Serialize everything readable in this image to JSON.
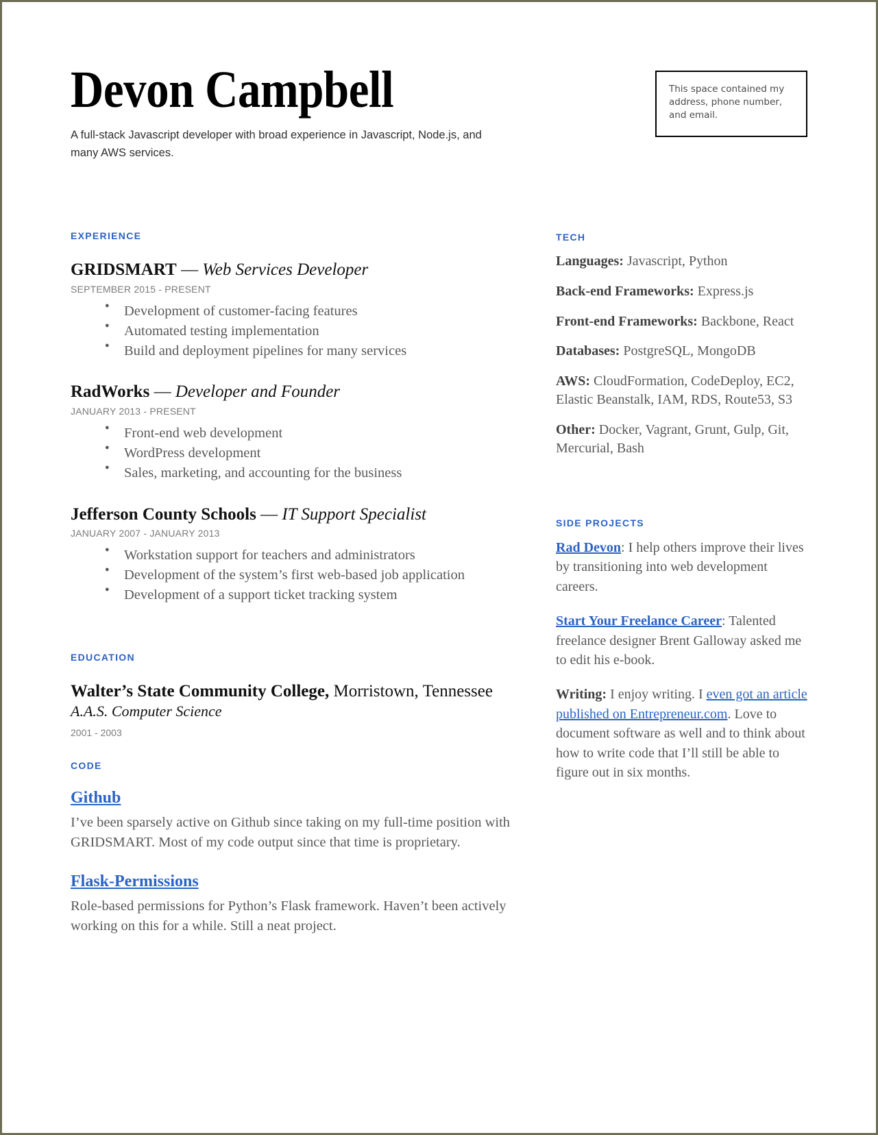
{
  "header": {
    "name": "Devon Campbell",
    "tagline": "A full-stack Javascript developer with broad experience in Javascript, Node.js, and many AWS services.",
    "contact_box_text": "This space contained my address, phone number, and email."
  },
  "sections": {
    "experience_heading": "EXPERIENCE",
    "education_heading": "EDUCATION",
    "code_heading": "CODE",
    "tech_heading": "TECH",
    "side_projects_heading": "SIDE PROJECTS"
  },
  "experience": [
    {
      "company": "GRIDSMART",
      "dash": " — ",
      "role": "Web Services Developer",
      "dates": "SEPTEMBER 2015 - PRESENT",
      "bullets": [
        "Development of customer-facing features",
        "Automated testing implementation",
        "Build and deployment pipelines for many services"
      ]
    },
    {
      "company": "RadWorks",
      "dash": " — ",
      "role": "Developer and Founder",
      "dates": "JANUARY 2013 - PRESENT",
      "bullets": [
        "Front-end web development",
        "WordPress development",
        "Sales, marketing, and accounting for the business"
      ]
    },
    {
      "company": "Jefferson County Schools",
      "dash": " — ",
      "role": "IT Support Specialist",
      "dates": "JANUARY 2007 - JANUARY 2013",
      "bullets": [
        "Workstation support for teachers and administrators",
        "Development of the system’s first web-based job application",
        "Development of a support ticket tracking system"
      ]
    }
  ],
  "education": {
    "school": "Walter’s State Community College,",
    "location": " Morristown, Tennessee",
    "degree": "A.A.S. Computer Science",
    "years": "2001 - 2003"
  },
  "code": [
    {
      "link": "Github",
      "description": "I’ve been sparsely active on Github since taking on my full-time position with GRIDSMART. Most of my code output since that time is proprietary."
    },
    {
      "link": "Flask-Permissions",
      "description": "Role-based permissions for Python’s Flask framework. Haven’t been actively working on this for a while. Still a neat project."
    }
  ],
  "tech": [
    {
      "label": "Languages:",
      "value": " Javascript, Python"
    },
    {
      "label": "Back-end Frameworks:",
      "value": " Express.js"
    },
    {
      "label": "Front-end Frameworks:",
      "value": " Backbone, React"
    },
    {
      "label": "Databases:",
      "value": " PostgreSQL, MongoDB"
    },
    {
      "label": "AWS:",
      "value": " CloudFormation, CodeDeploy, EC2, Elastic Beanstalk, IAM, RDS, Route53, S3"
    },
    {
      "label": "Other:",
      "value": " Docker, Vagrant, Grunt, Gulp, Git, Mercurial, Bash"
    }
  ],
  "side_projects": [
    {
      "link": "Rad Devon",
      "after_link": ": I help others improve their lives by transitioning into web development careers."
    },
    {
      "link": "Start Your Freelance Career",
      "after_link": ": Talented freelance designer Brent Galloway asked me to edit his e-book."
    },
    {
      "label": "Writing:",
      "text_before": " I enjoy writing. I ",
      "inline_link": "even got an article published on Entrepreneur.com",
      "text_after": ". Love to document software as well and to think about how to write code that I’ll still be able to figure out in six months."
    }
  ],
  "colors": {
    "accent_blue": "#2b62c4",
    "body_gray": "#58585a",
    "muted_gray": "#7b7b7b",
    "page_border": "#6d6d55"
  }
}
